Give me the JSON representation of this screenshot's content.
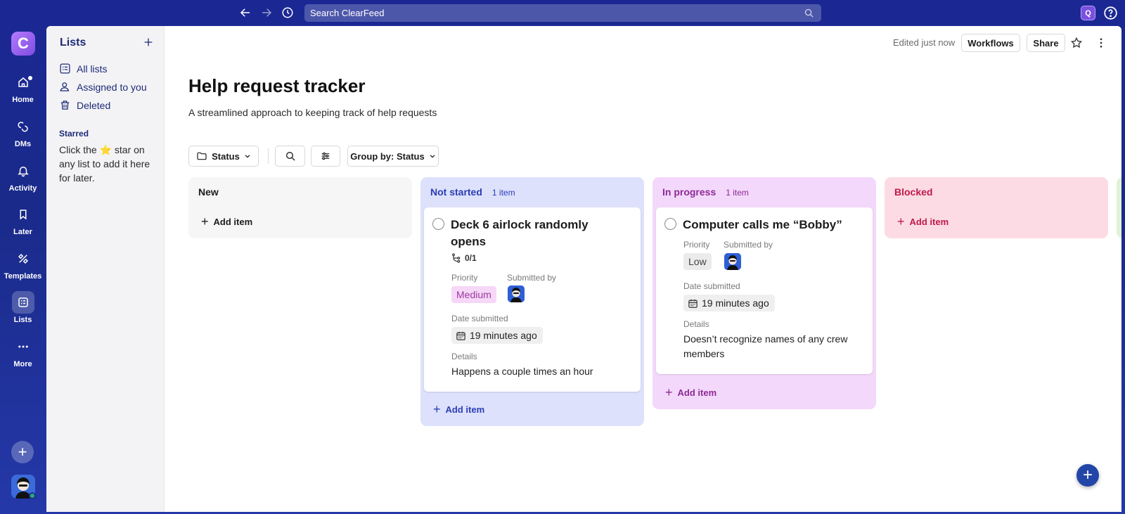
{
  "topbar": {
    "search_placeholder": "Search ClearFeed",
    "app_badge": "Q"
  },
  "workspace": {
    "initial": "C"
  },
  "rail": {
    "items": [
      {
        "label": "Home"
      },
      {
        "label": "DMs"
      },
      {
        "label": "Activity"
      },
      {
        "label": "Later"
      },
      {
        "label": "Templates"
      },
      {
        "label": "Lists"
      },
      {
        "label": "More"
      }
    ]
  },
  "sidebar": {
    "title": "Lists",
    "links": [
      {
        "label": "All lists"
      },
      {
        "label": "Assigned to you"
      },
      {
        "label": "Deleted"
      }
    ],
    "starred_heading": "Starred",
    "starred_help_before": "Click the",
    "starred_help_emoji": "⭐",
    "starred_help_after": "star on any list to add it here for later."
  },
  "header": {
    "edited": "Edited just now",
    "workflows": "Workflows",
    "share": "Share"
  },
  "page": {
    "title": "Help request tracker",
    "description": "A streamlined approach to keeping track of help requests"
  },
  "toolbar": {
    "status_filter": "Status",
    "group_by": "Group by: Status"
  },
  "board": {
    "add_item_label": "Add item",
    "columns": [
      {
        "name": "New",
        "count": "",
        "color": "#f6f6f6",
        "text_color": "#1d1c1d"
      },
      {
        "name": "Not started",
        "count": "1 item",
        "color": "#dde1fb",
        "text_color": "#2b3db5"
      },
      {
        "name": "In progress",
        "count": "1 item",
        "color": "#f3d8fb",
        "text_color": "#8e2a94"
      },
      {
        "name": "Blocked",
        "count": "",
        "color": "#fcdbe4",
        "text_color": "#c0194b"
      }
    ],
    "cards": [
      {
        "title": "Deck 6 airlock randomly opens",
        "subtasks": "0/1",
        "priority_label": "Priority",
        "priority": "Medium",
        "submitted_label": "Submitted by",
        "date_label": "Date submitted",
        "date": "19 minutes ago",
        "details_label": "Details",
        "details": "Happens a couple times an hour"
      },
      {
        "title": "Computer calls me “Bobby”",
        "priority_label": "Priority",
        "priority": "Low",
        "submitted_label": "Submitted by",
        "date_label": "Date submitted",
        "date": "19 minutes ago",
        "details_label": "Details",
        "details": "Doesn’t recognize names of any crew members"
      }
    ]
  }
}
